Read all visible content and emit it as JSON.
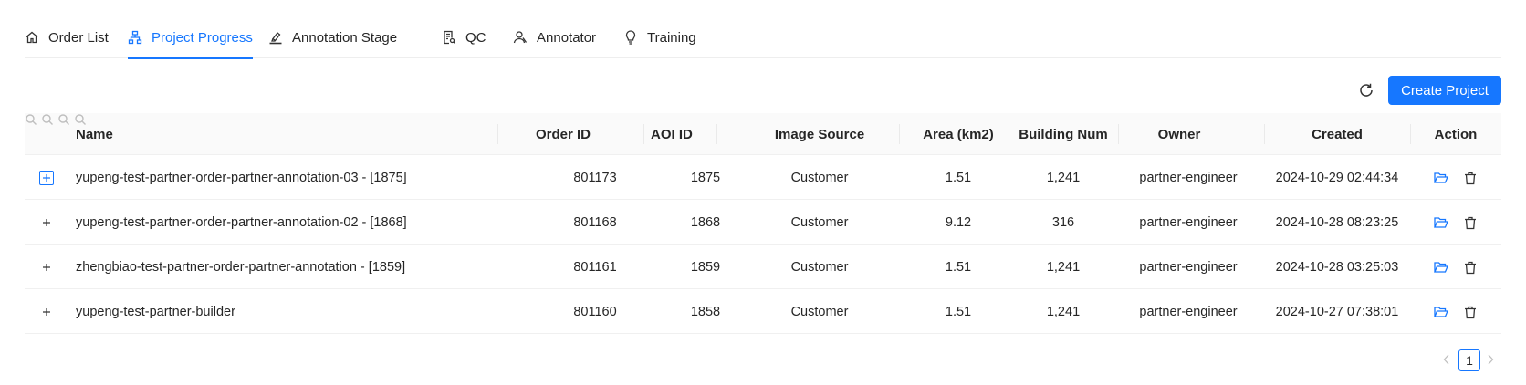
{
  "tabs": [
    {
      "label": "Order List",
      "icon": "home-icon"
    },
    {
      "label": "Project Progress",
      "icon": "sitemap-icon",
      "active": true
    },
    {
      "label": "Annotation Stage",
      "icon": "highlight-icon"
    },
    {
      "label": "QC",
      "icon": "audit-icon"
    },
    {
      "label": "Annotator",
      "icon": "user-icon"
    },
    {
      "label": "Training",
      "icon": "bulb-icon"
    }
  ],
  "toolbar": {
    "create_label": "Create Project",
    "refresh_icon": "reload-icon"
  },
  "table": {
    "headers": {
      "name": "Name",
      "order_id": "Order ID",
      "aoi_id": "AOI ID",
      "image_source": "Image Source",
      "area": "Area (km2)",
      "building_num": "Building Num",
      "owner": "Owner",
      "created": "Created",
      "action": "Action"
    },
    "rows": [
      {
        "name": "yupeng-test-partner-order-partner-annotation-03 - [1875]",
        "order_id": "801173",
        "aoi_id": "1875",
        "image_source": "Customer",
        "area": "1.51",
        "building_num": "1,241",
        "owner": "partner-engineer",
        "created": "2024-10-29 02:44:34",
        "expand": "+"
      },
      {
        "name": "yupeng-test-partner-order-partner-annotation-02 - [1868]",
        "order_id": "801168",
        "aoi_id": "1868",
        "image_source": "Customer",
        "area": "9.12",
        "building_num": "316",
        "owner": "partner-engineer",
        "created": "2024-10-28 08:23:25",
        "expand": "+"
      },
      {
        "name": "zhengbiao-test-partner-order-partner-annotation - [1859]",
        "order_id": "801161",
        "aoi_id": "1859",
        "image_source": "Customer",
        "area": "1.51",
        "building_num": "1,241",
        "owner": "partner-engineer",
        "created": "2024-10-28 03:25:03",
        "expand": "+"
      },
      {
        "name": "yupeng-test-partner-builder",
        "order_id": "801160",
        "aoi_id": "1858",
        "image_source": "Customer",
        "area": "1.51",
        "building_num": "1,241",
        "owner": "partner-engineer",
        "created": "2024-10-27 07:38:01",
        "expand": "+"
      }
    ]
  },
  "pagination": {
    "current": "1"
  },
  "colors": {
    "accent": "#1677ff",
    "header_bg": "#fafafa"
  }
}
